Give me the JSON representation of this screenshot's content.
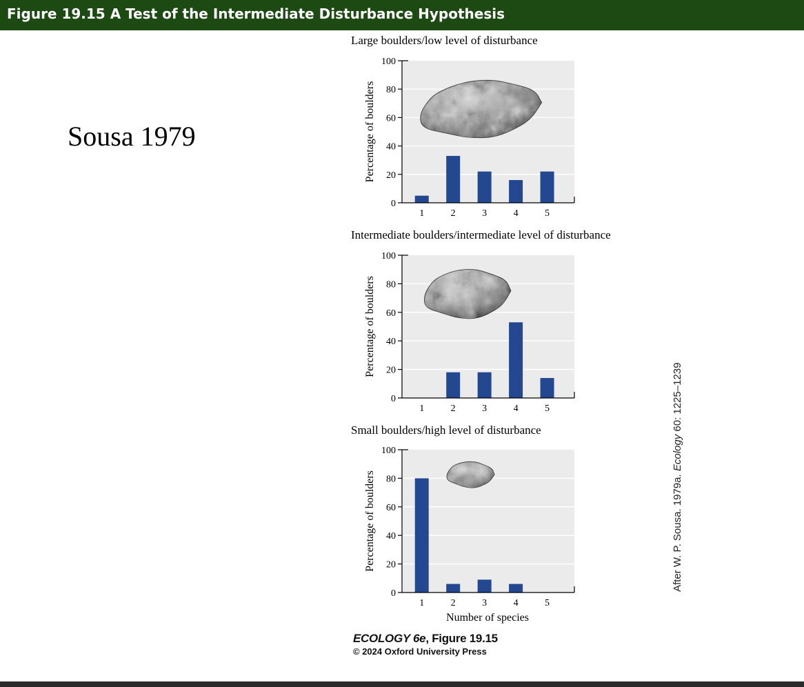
{
  "header": {
    "title": "Figure 19.15  A Test of the Intermediate Disturbance Hypothesis"
  },
  "side_title": "Sousa 1979",
  "attribution": {
    "prefix": "After W. P. Sousa. 1979a. ",
    "journal": "Ecology",
    "suffix": " 60: 1225–1239"
  },
  "credit": {
    "book": "ECOLOGY 6e",
    "figure": ", Figure 19.15",
    "copyright": "© 2024 Oxford University Press"
  },
  "colors": {
    "header_bg": "#1d4a12",
    "bar": "#24488f",
    "plot_bg": "#ebebeb",
    "gridline": "#ffffff"
  },
  "icons": [
    "boulder-large-image",
    "boulder-intermediate-image",
    "boulder-small-image"
  ],
  "chart_data": [
    {
      "type": "bar",
      "title": "Large boulders/low level of disturbance",
      "categories": [
        "1",
        "2",
        "3",
        "4",
        "5"
      ],
      "values": [
        5,
        33,
        22,
        16,
        22
      ],
      "ylabel": "Percentage of boulders",
      "xlabel": "",
      "ylim": [
        0,
        100
      ],
      "yticks": [
        "0",
        "20",
        "40",
        "60",
        "80",
        "100"
      ],
      "grid": true
    },
    {
      "type": "bar",
      "title": "Intermediate boulders/intermediate level of disturbance",
      "categories": [
        "1",
        "2",
        "3",
        "4",
        "5"
      ],
      "values": [
        0,
        18,
        18,
        53,
        14
      ],
      "ylabel": "Percentage of boulders",
      "xlabel": "",
      "ylim": [
        0,
        100
      ],
      "yticks": [
        "0",
        "20",
        "40",
        "60",
        "80",
        "100"
      ],
      "grid": true
    },
    {
      "type": "bar",
      "title": "Small boulders/high level of disturbance",
      "categories": [
        "1",
        "2",
        "3",
        "4",
        "5"
      ],
      "values": [
        80,
        6,
        9,
        6,
        0
      ],
      "ylabel": "Percentage of boulders",
      "xlabel": "Number of species",
      "ylim": [
        0,
        100
      ],
      "yticks": [
        "0",
        "20",
        "40",
        "60",
        "80",
        "100"
      ],
      "grid": true
    }
  ]
}
